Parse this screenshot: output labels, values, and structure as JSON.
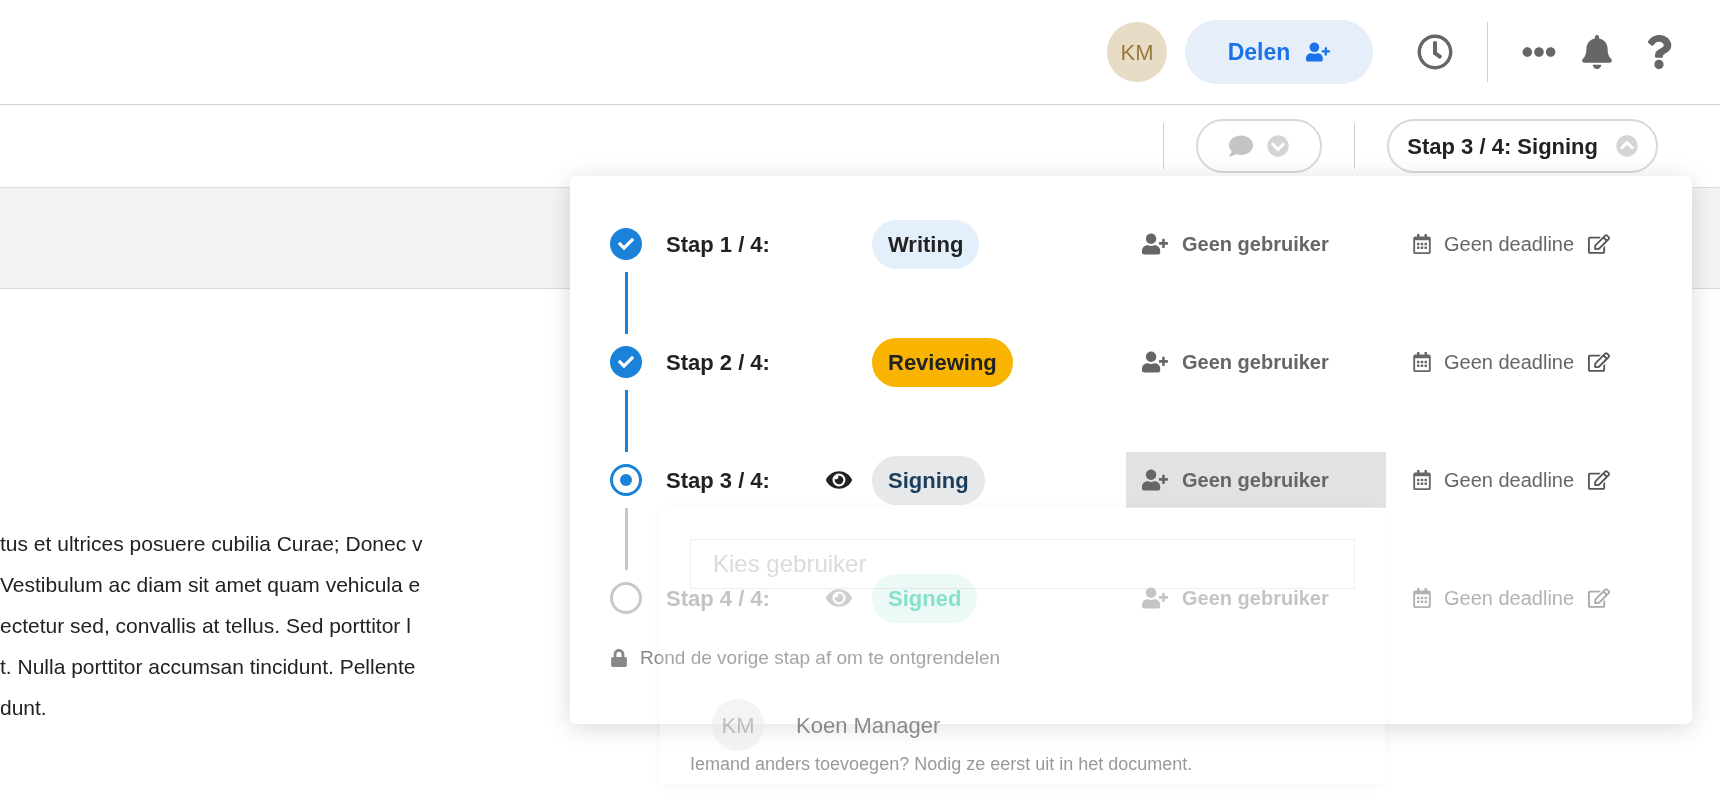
{
  "top_bar": {
    "avatar": "KM",
    "share_button": "Delen"
  },
  "toolbar": {
    "step_button": "Stap 3 / 4: Signing"
  },
  "document": {
    "lines": [
      "tus et ultrices posuere cubilia Curae; Donec v",
      "Vestibulum ac diam sit amet quam vehicula e",
      "ectetur sed, convallis at tellus. Sed porttitor l",
      "t. Nulla porttitor accumsan tincidunt. Pellente",
      "dunt."
    ]
  },
  "steps": [
    {
      "label": "Stap 1 / 4:",
      "name": "Writing",
      "color": "#e3f0fb",
      "kind": "done",
      "watching": false,
      "assignee": "Geen gebruiker",
      "assignee_highlighted": false,
      "deadline": "Geen deadline"
    },
    {
      "label": "Stap 2 / 4:",
      "name": "Reviewing",
      "color": "#f8b400",
      "kind": "done",
      "watching": false,
      "assignee": "Geen gebruiker",
      "assignee_highlighted": false,
      "deadline": "Geen deadline"
    },
    {
      "label": "Stap 3 / 4:",
      "name": "Signing",
      "color": "#e6e8ea",
      "kind": "current",
      "watching": true,
      "assignee": "Geen gebruiker",
      "assignee_highlighted": true,
      "deadline": "Geen deadline"
    },
    {
      "label": "Stap 4 / 4:",
      "name": "Signed",
      "color": "#e6f7f4",
      "kind": "locked",
      "watching": true,
      "assignee": "Geen gebruiker",
      "assignee_highlighted": false,
      "deadline": "Geen deadline"
    }
  ],
  "lock_note": "Rond de vorige stap af om te ontgrendelen",
  "user_picker": {
    "placeholder": "Kies gebruiker",
    "options": [
      {
        "initials": "KM",
        "name": "Koen Manager"
      }
    ],
    "hint": "Iemand anders toevoegen? Nodig ze eerst uit in het document."
  }
}
